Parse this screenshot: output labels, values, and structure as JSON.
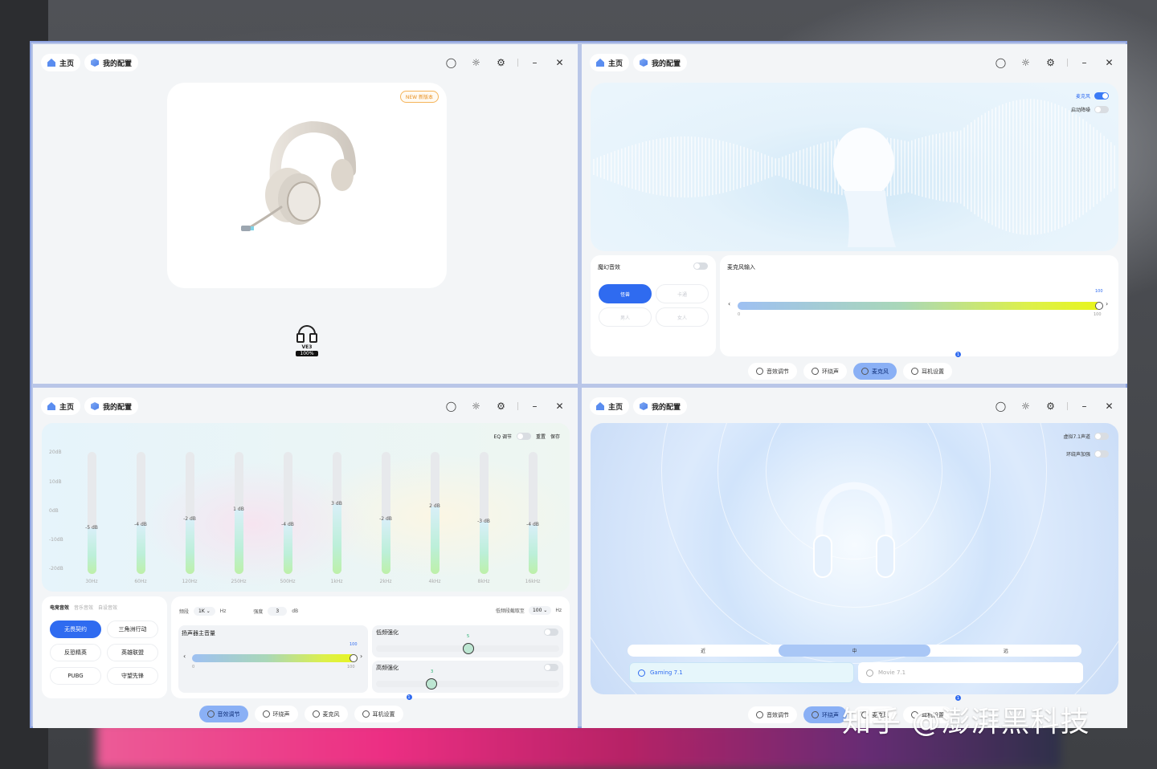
{
  "titlebar": {
    "home": "主页",
    "config": "我的配置"
  },
  "window1": {
    "new_badge": "NEW 新版本",
    "device_name": "VE3",
    "battery": "100%"
  },
  "window2": {
    "mic_toggle": "麦克风",
    "noise_toggle": "启动降噪",
    "voice_fx_title": "魔幻音效",
    "voice_buttons": [
      "怪兽",
      "卡通",
      "男人",
      "女人"
    ],
    "mic_input_title": "麦克风输入",
    "mic_value": "100",
    "mic_min": "0",
    "mic_max": "100"
  },
  "nav": {
    "sound": "音效调节",
    "surround": "环绕声",
    "mic": "麦克风",
    "settings": "耳机设置",
    "badge": "1"
  },
  "window3": {
    "eq_toggle": "EQ 调节",
    "reset": "重置",
    "save": "保存",
    "y_labels": [
      "20dB",
      "10dB",
      "0dB",
      "-10dB",
      "-20dB"
    ],
    "bands": [
      {
        "hz": "30Hz",
        "label": "-5 dB",
        "gain": -5
      },
      {
        "hz": "60Hz",
        "label": "-4 dB",
        "gain": -4
      },
      {
        "hz": "120Hz",
        "label": "-2 dB",
        "gain": -2
      },
      {
        "hz": "250Hz",
        "label": "1 dB",
        "gain": 1
      },
      {
        "hz": "500Hz",
        "label": "-4 dB",
        "gain": -4
      },
      {
        "hz": "1kHz",
        "label": "3 dB",
        "gain": 3
      },
      {
        "hz": "2kHz",
        "label": "-2 dB",
        "gain": -2
      },
      {
        "hz": "4kHz",
        "label": "2 dB",
        "gain": 2
      },
      {
        "hz": "8kHz",
        "label": "-3 dB",
        "gain": -3
      },
      {
        "hz": "16kHz",
        "label": "-4 dB",
        "gain": -4
      }
    ],
    "preset_tabs": [
      "电竞音效",
      "音乐音效",
      "自设音效"
    ],
    "presets": [
      "无畏契约",
      "三角洲行动",
      "反恐精英",
      "英雄联盟",
      "PUBG",
      "守望先锋"
    ],
    "freq_label": "频段",
    "freq_value": "1K",
    "freq_unit": "Hz",
    "gain_label": "强度",
    "gain_value": "3",
    "gain_unit": "dB",
    "lowcut_label": "低频段截取至",
    "lowcut_value": "100",
    "lowcut_unit": "Hz",
    "master_title": "扬声器主音量",
    "master_value": "100",
    "master_min": "0",
    "master_max": "100",
    "bass_title": "低频强化",
    "bass_value": "5",
    "treble_title": "高频强化",
    "treble_value": "3"
  },
  "window4": {
    "virtual71": "虚拟7.1声道",
    "surround_boost": "环绕声加强",
    "distance": [
      "近",
      "中",
      "远"
    ],
    "modes": [
      "Gaming 7.1",
      "Movie 7.1"
    ]
  },
  "watermark": "知乎 @澎湃黑科技"
}
